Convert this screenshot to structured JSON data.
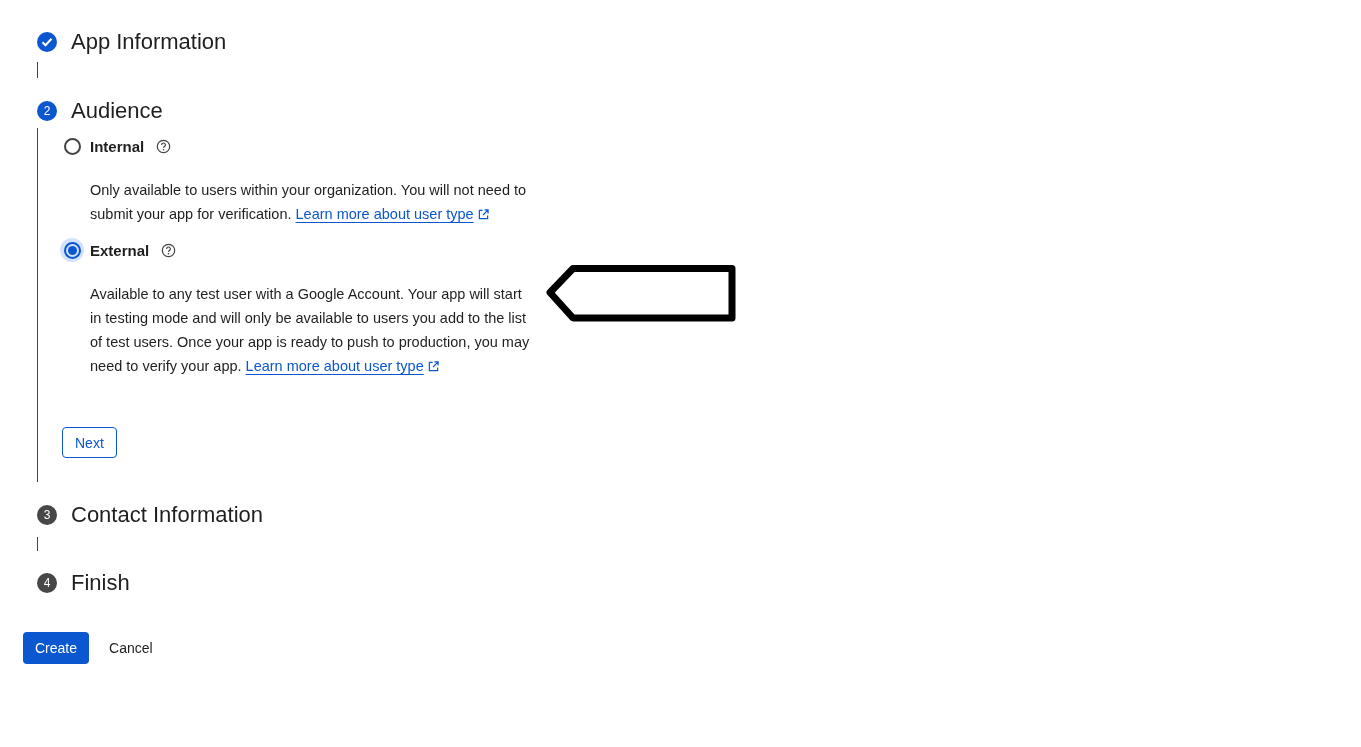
{
  "steps": [
    {
      "done": true,
      "color": "#0b57d0",
      "title": "App Information"
    },
    {
      "done": false,
      "color": "#0b57d0",
      "number": "2",
      "title": "Audience",
      "options": [
        {
          "label": "Internal",
          "selected": false,
          "description": "Only available to users within your organization. You will not need to submit your app for verification.",
          "link": "Learn more about user type"
        },
        {
          "label": "External",
          "selected": true,
          "description": "Available to any test user with a Google Account. Your app will start in testing mode and will only be available to users you add to the list of test users. Once your app is ready to push to production, you may need to verify your app.",
          "link": "Learn more about user type"
        }
      ],
      "next_button": "Next"
    },
    {
      "done": false,
      "color": "#474747",
      "number": "3",
      "title": "Contact Information"
    },
    {
      "done": false,
      "color": "#474747",
      "number": "4",
      "title": "Finish"
    }
  ],
  "actions": [
    {
      "kind": "primary",
      "label": "Create"
    },
    {
      "kind": "text",
      "label": "Cancel"
    }
  ],
  "annotations": [
    {
      "kind": "arrow"
    }
  ]
}
